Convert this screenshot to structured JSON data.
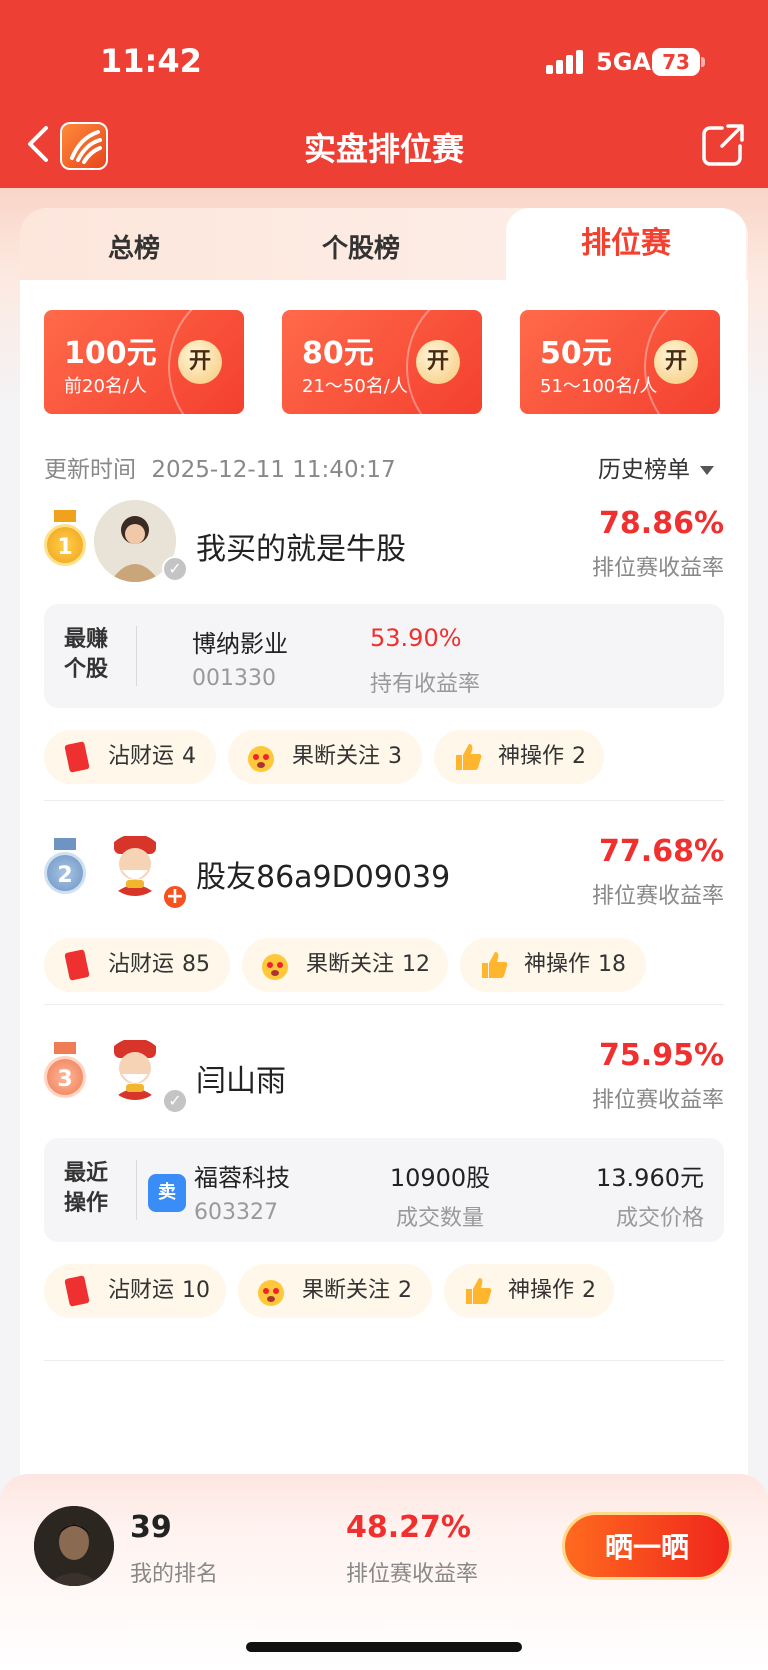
{
  "status_bar": {
    "time": "11:42",
    "network": "5GA",
    "battery": "73"
  },
  "nav": {
    "title": "实盘排位赛"
  },
  "tabs": [
    {
      "label": "总榜",
      "active": false
    },
    {
      "label": "个股榜",
      "active": false
    },
    {
      "label": "排位赛",
      "active": true
    }
  ],
  "rewards": [
    {
      "amount": "100元",
      "range": "前20名/人",
      "open": "开"
    },
    {
      "amount": "80元",
      "range": "21～50名/人",
      "open": "开"
    },
    {
      "amount": "50元",
      "range": "51～100名/人",
      "open": "开"
    }
  ],
  "update": {
    "label": "更新时间",
    "time": "2025-12-11 11:40:17"
  },
  "history_label": "历史榜单",
  "rate_label": "排位赛收益率",
  "entries": [
    {
      "rank": "1",
      "name": "我买的就是牛股",
      "rate": "78.86%",
      "detail": {
        "tag": "最赚个股",
        "stock_name": "博纳影业",
        "stock_code": "001330",
        "value": "53.90%",
        "value_label": "持有收益率"
      },
      "reactions": [
        {
          "label": "沾财运",
          "count": "4"
        },
        {
          "label": "果断关注",
          "count": "3"
        },
        {
          "label": "神操作",
          "count": "2"
        }
      ]
    },
    {
      "rank": "2",
      "name": "股友86a9D09039",
      "rate": "77.68%",
      "reactions": [
        {
          "label": "沾财运",
          "count": "85"
        },
        {
          "label": "果断关注",
          "count": "12"
        },
        {
          "label": "神操作",
          "count": "18"
        }
      ]
    },
    {
      "rank": "3",
      "name": "闫山雨",
      "rate": "75.95%",
      "detail": {
        "tag": "最近操作",
        "action": "卖",
        "stock_name": "福蓉科技",
        "stock_code": "603327",
        "qty": "10900股",
        "qty_label": "成交数量",
        "price": "13.960元",
        "price_label": "成交价格"
      },
      "reactions": [
        {
          "label": "沾财运",
          "count": "10"
        },
        {
          "label": "果断关注",
          "count": "2"
        },
        {
          "label": "神操作",
          "count": "2"
        }
      ]
    }
  ],
  "me": {
    "rank": "39",
    "rank_label": "我的排名",
    "rate": "48.27%",
    "rate_label": "排位赛收益率",
    "share_button": "晒一晒"
  },
  "colors": {
    "brand_red": "#ee3f35",
    "rate_red": "#f02f2f",
    "active_tab": "#f4402f"
  }
}
